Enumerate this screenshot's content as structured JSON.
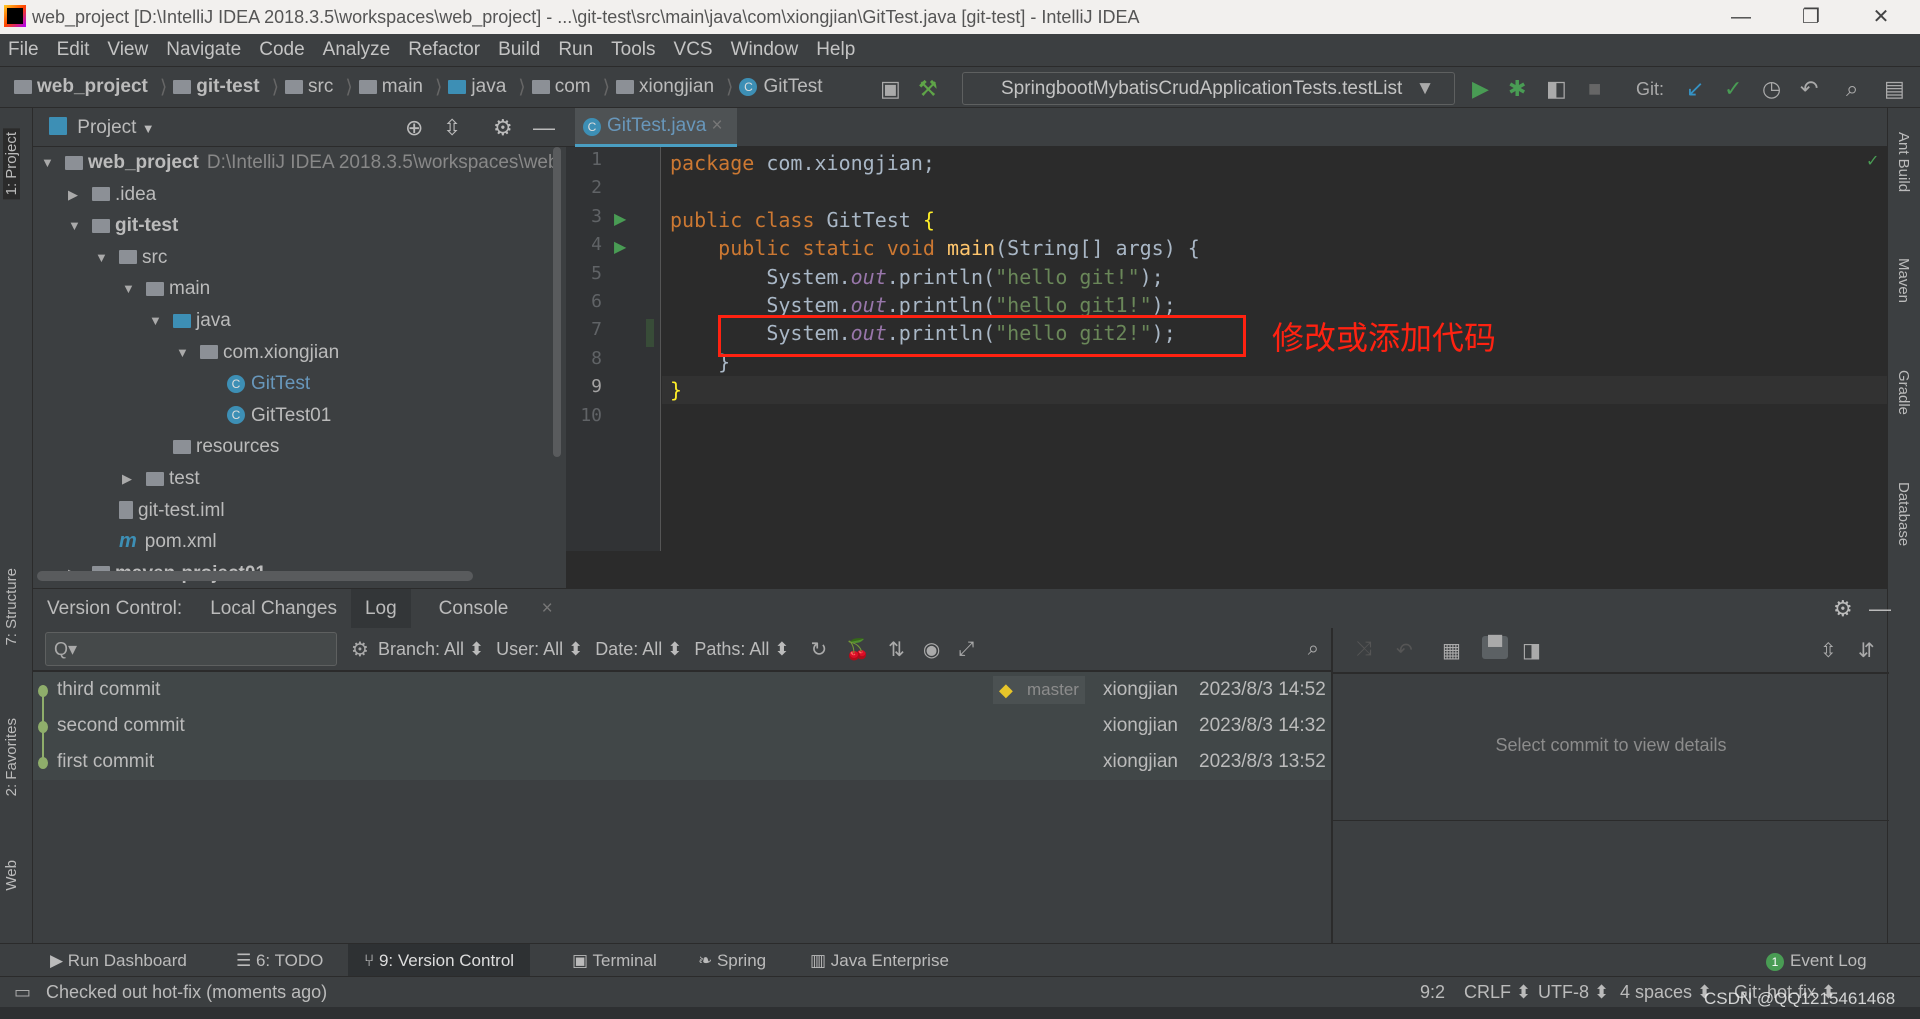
{
  "window": {
    "title": "web_project [D:\\IntelliJ IDEA 2018.3.5\\workspaces\\web_project] - ...\\git-test\\src\\main\\java\\com\\xiongjian\\GitTest.java [git-test] - IntelliJ IDEA",
    "minimize": "—",
    "restore": "❐",
    "close": "✕"
  },
  "menu": [
    "File",
    "Edit",
    "View",
    "Navigate",
    "Code",
    "Analyze",
    "Refactor",
    "Build",
    "Run",
    "Tools",
    "VCS",
    "Window",
    "Help"
  ],
  "breadcrumb": [
    "web_project",
    "git-test",
    "src",
    "main",
    "java",
    "com",
    "xiongjian",
    "GitTest"
  ],
  "toolbar": {
    "run_config": "SpringbootMybatisCrudApplicationTests.testList",
    "git_label": "Git:"
  },
  "left_strip": {
    "project": "1: Project",
    "structure": "7: Structure",
    "favorites": "2: Favorites",
    "web": "Web"
  },
  "right_strip": {
    "ant": "Ant Build",
    "maven": "Maven",
    "gradle": "Gradle",
    "database": "Database"
  },
  "project": {
    "title": "Project",
    "tree": [
      {
        "label": "web_project",
        "extra": "D:\\IntelliJ IDEA 2018.3.5\\workspaces\\web",
        "depth": 0,
        "arrow": "▼",
        "bold": true,
        "icon": "module"
      },
      {
        "label": ".idea",
        "depth": 1,
        "arrow": "▶",
        "icon": "folder"
      },
      {
        "label": "git-test",
        "depth": 1,
        "arrow": "▼",
        "bold": true,
        "icon": "module"
      },
      {
        "label": "src",
        "depth": 2,
        "arrow": "▼",
        "icon": "folder"
      },
      {
        "label": "main",
        "depth": 3,
        "arrow": "▼",
        "icon": "folder"
      },
      {
        "label": "java",
        "depth": 4,
        "arrow": "▼",
        "icon": "source-folder"
      },
      {
        "label": "com.xiongjian",
        "depth": 5,
        "arrow": "▼",
        "icon": "package"
      },
      {
        "label": "GitTest",
        "depth": 6,
        "icon": "class",
        "modified": true
      },
      {
        "label": "GitTest01",
        "depth": 6,
        "icon": "class"
      },
      {
        "label": "resources",
        "depth": 4,
        "icon": "folder"
      },
      {
        "label": "test",
        "depth": 3,
        "arrow": "▶",
        "icon": "folder"
      },
      {
        "label": "git-test.iml",
        "depth": 2,
        "icon": "iml"
      },
      {
        "label": "pom.xml",
        "depth": 2,
        "icon": "maven"
      },
      {
        "label": "maven-project01",
        "depth": 1,
        "arrow": "▶",
        "bold": true,
        "icon": "module"
      }
    ]
  },
  "editor": {
    "tab": "GitTest.java",
    "lines": [
      [
        [
          "kw",
          "package "
        ],
        [
          "",
          "com.xiongjian;"
        ]
      ],
      [],
      [
        [
          "kw",
          "public class "
        ],
        [
          "",
          "GitTest "
        ],
        [
          "br",
          "{"
        ]
      ],
      [
        [
          "kw",
          "    public static void "
        ],
        [
          "fn",
          "main"
        ],
        [
          "",
          "(String[] args) {"
        ]
      ],
      [
        [
          "",
          "        System."
        ],
        [
          "fld",
          "out"
        ],
        [
          "",
          ".println("
        ],
        [
          "str",
          "\"hello git!\""
        ],
        [
          "",
          ");"
        ]
      ],
      [
        [
          "",
          "        System."
        ],
        [
          "fld",
          "out"
        ],
        [
          "",
          ".println("
        ],
        [
          "str",
          "\"hello git1!\""
        ],
        [
          "",
          ");"
        ]
      ],
      [
        [
          "",
          "        System."
        ],
        [
          "fld",
          "out"
        ],
        [
          "",
          ".println("
        ],
        [
          "str",
          "\"hello git2!\""
        ],
        [
          "",
          ");"
        ]
      ],
      [
        [
          "",
          "    }"
        ]
      ],
      [
        [
          "br",
          "}"
        ]
      ],
      []
    ],
    "annotation": "修改或添加代码"
  },
  "vc": {
    "label": "Version Control:",
    "tabs": [
      "Local Changes",
      "Log",
      "Console"
    ],
    "active_tab": "Log",
    "search_placeholder": "Q▾",
    "filters": [
      "Branch: All ⬍",
      "User: All ⬍",
      "Date: All ⬍",
      "Paths: All ⬍"
    ],
    "commits": [
      {
        "message": "third commit",
        "branch": "master",
        "author": "xiongjian",
        "date": "2023/8/3 14:52"
      },
      {
        "message": "second commit",
        "branch": "",
        "author": "xiongjian",
        "date": "2023/8/3 14:32"
      },
      {
        "message": "first commit",
        "branch": "",
        "author": "xiongjian",
        "date": "2023/8/3 13:52"
      }
    ],
    "details_empty": "Select commit to view details"
  },
  "bottom_tabs": [
    "Run Dashboard",
    "6: TODO",
    "9: Version Control",
    "Terminal",
    "Spring",
    "Java Enterprise"
  ],
  "event_log": "Event Log",
  "event_count": "1",
  "status": {
    "message": "Checked out hot-fix (moments ago)",
    "position": "9:2",
    "line_sep": "CRLF ⬍",
    "encoding": "UTF-8 ⬍",
    "indent": "4 spaces ⬍",
    "branch": "Git: hot-fix ⬍"
  },
  "watermark": "CSDN @QQ1215461468",
  "colors": {
    "accent": "#4a9ec2",
    "keyword": "#cc7832",
    "string": "#6a8759",
    "annotation": "#ff2211"
  }
}
